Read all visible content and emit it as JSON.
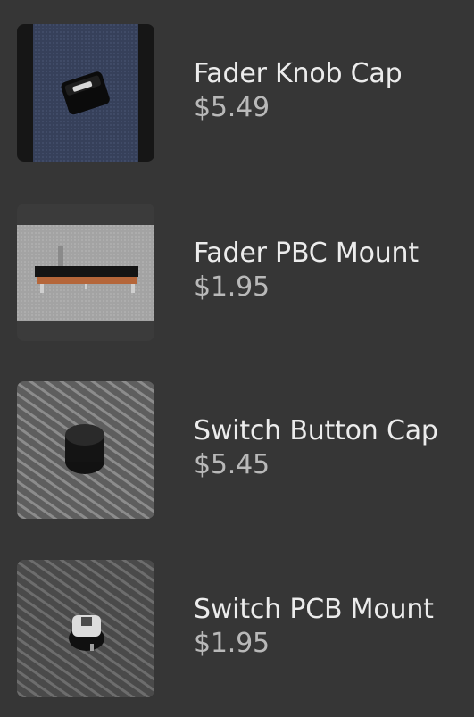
{
  "products": [
    {
      "name": "Fader Knob Cap",
      "price": "$5.49",
      "image_icon": "fader-knob-cap-photo"
    },
    {
      "name": "Fader PBC Mount",
      "price": "$1.95",
      "image_icon": "fader-pcb-mount-photo"
    },
    {
      "name": "Switch Button Cap",
      "price": "$5.45",
      "image_icon": "switch-button-cap-photo"
    },
    {
      "name": "Switch PCB Mount",
      "price": "$1.95",
      "image_icon": "switch-pcb-mount-photo"
    }
  ],
  "colors": {
    "background": "#363636",
    "name_text": "#ececec",
    "price_text": "#b9b9b9"
  }
}
